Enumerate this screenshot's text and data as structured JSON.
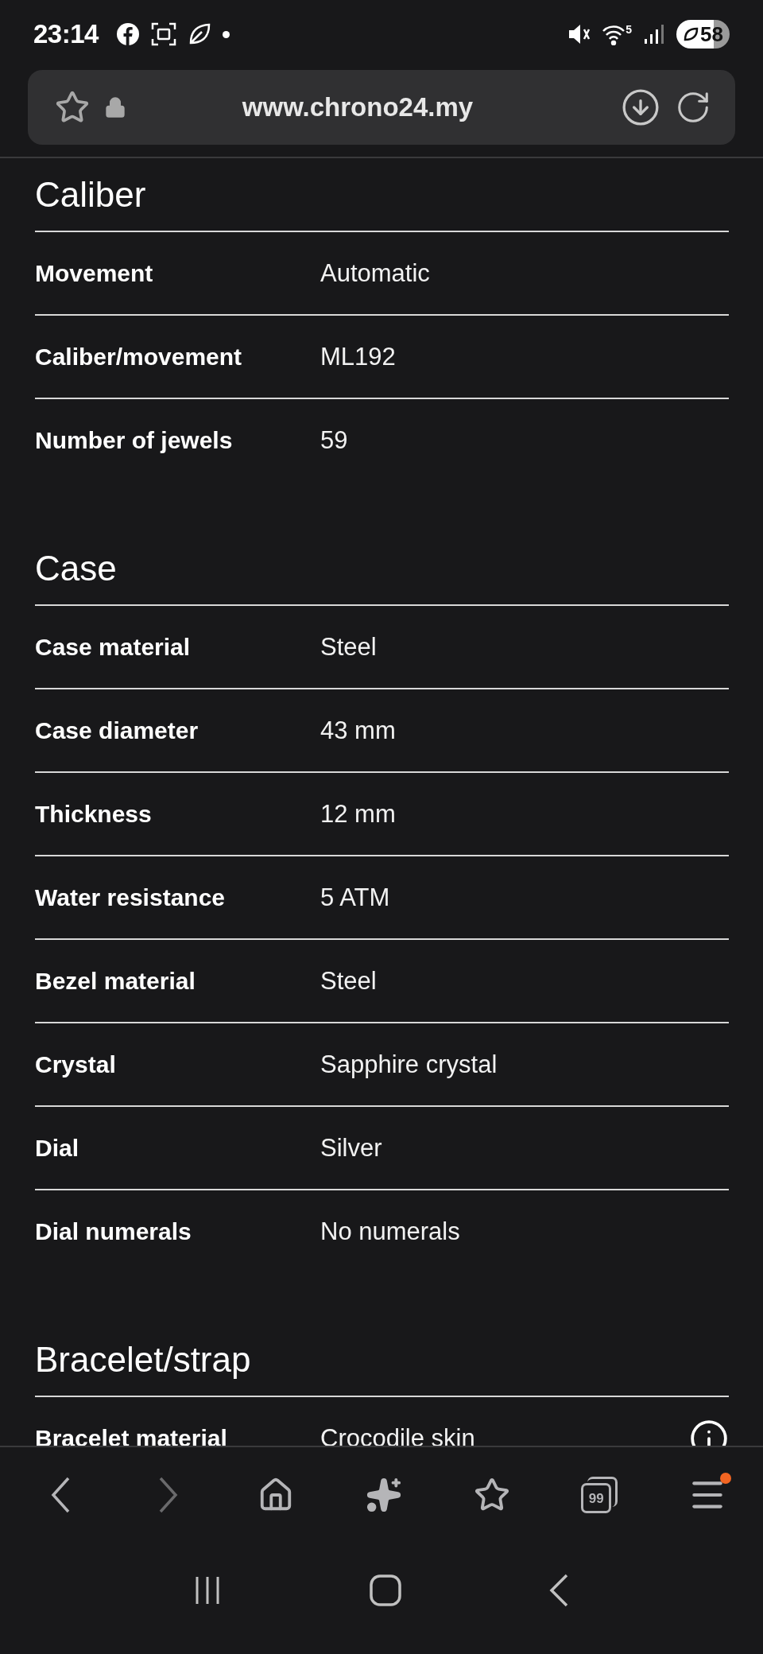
{
  "status_bar": {
    "time": "23:14",
    "wifi_badge": "5",
    "battery": "58"
  },
  "address_bar": {
    "url": "www.chrono24.my"
  },
  "sections": [
    {
      "title": "Caliber",
      "rows": [
        {
          "label": "Movement",
          "value": "Automatic",
          "info": false
        },
        {
          "label": "Caliber/movement",
          "value": "ML192",
          "info": false
        },
        {
          "label": "Number of jewels",
          "value": "59",
          "info": false
        }
      ]
    },
    {
      "title": "Case",
      "rows": [
        {
          "label": "Case material",
          "value": "Steel",
          "info": false
        },
        {
          "label": "Case diameter",
          "value": "43 mm",
          "info": false
        },
        {
          "label": "Thickness",
          "value": "12 mm",
          "info": false
        },
        {
          "label": "Water resistance",
          "value": "5 ATM",
          "info": false
        },
        {
          "label": "Bezel material",
          "value": "Steel",
          "info": false
        },
        {
          "label": "Crystal",
          "value": "Sapphire crystal",
          "info": false
        },
        {
          "label": "Dial",
          "value": "Silver",
          "info": false
        },
        {
          "label": "Dial numerals",
          "value": "No numerals",
          "info": false
        }
      ]
    },
    {
      "title": "Bracelet/strap",
      "rows": [
        {
          "label": "Bracelet material",
          "value": "Crocodile skin",
          "info": true
        }
      ]
    }
  ],
  "toolbar": [
    {
      "kind": "back",
      "disabled": false,
      "notification": false
    },
    {
      "kind": "forward",
      "disabled": true,
      "notification": false
    },
    {
      "kind": "home",
      "disabled": false,
      "notification": false
    },
    {
      "kind": "assistant",
      "disabled": false,
      "notification": false
    },
    {
      "kind": "bookmarks",
      "disabled": false,
      "notification": false
    },
    {
      "kind": "tabs",
      "disabled": false,
      "notification": false,
      "count": "99"
    },
    {
      "kind": "menu",
      "disabled": false,
      "notification": true
    }
  ]
}
